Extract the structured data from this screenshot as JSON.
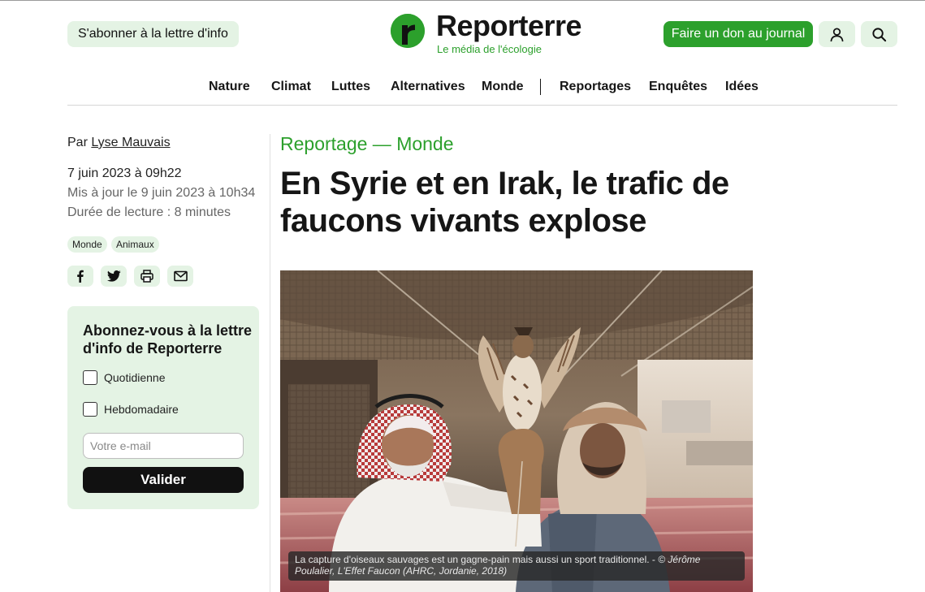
{
  "header": {
    "subscribe_label": "S'abonner à la lettre d'info",
    "logo_name": "Reporterre",
    "logo_tagline": "Le média de l'écologie",
    "donate_label": "Faire un don au journal",
    "account_icon": "user-icon",
    "search_icon": "search-icon"
  },
  "nav": {
    "items": [
      "Nature",
      "Climat",
      "Luttes",
      "Alternatives",
      "Monde",
      "Reportages",
      "Enquêtes",
      "Idées"
    ]
  },
  "meta": {
    "by_prefix": "Par",
    "author": "Lyse Mauvais",
    "date": "7 juin 2023 à 09h22",
    "updated": "Mis à jour le 9 juin 2023 à 10h34",
    "reading_time": "Durée de lecture : 8 minutes",
    "tags": [
      "Monde",
      "Animaux"
    ],
    "share_icons": [
      "facebook-icon",
      "twitter-icon",
      "print-icon",
      "mail-icon"
    ]
  },
  "newsletter": {
    "title": "Abonnez-vous à la lettre d'info de Reporterre",
    "options": [
      "Quotidienne",
      "Hebdomadaire"
    ],
    "email_placeholder": "Votre e-mail",
    "submit_label": "Valider"
  },
  "article": {
    "kicker": "Reportage — Monde",
    "title": "En Syrie et en Irak, le trafic de faucons vivants explose",
    "caption": "La capture d'oiseaux sauvages est un gagne-pain mais aussi un sport traditionnel. - ",
    "credit": "© Jérôme Poulalier, L'Effet Faucon (AHRC, Jordanie, 2018)"
  },
  "colors": {
    "brand_green": "#2ca02c",
    "light_green": "#e4f3e4",
    "text": "#161616"
  }
}
